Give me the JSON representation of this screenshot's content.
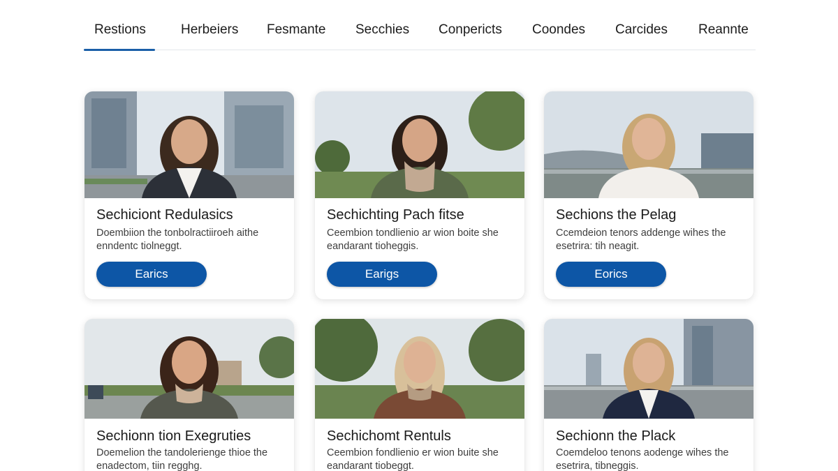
{
  "tabs": [
    {
      "label": "Restions",
      "active": true
    },
    {
      "label": "Herbeiers"
    },
    {
      "label": "Fesmante"
    },
    {
      "label": "Secchies"
    },
    {
      "label": "Conperiᴄts"
    },
    {
      "label": "Coondes"
    },
    {
      "label": "Carcides"
    },
    {
      "label": "Reannte"
    }
  ],
  "accent_color": "#0d56a6",
  "cards": [
    {
      "title": "Sechiciont Redulasics",
      "desc": "Doembiion the tonbolractiiroeh aithe enndentc tiolneggt.",
      "button": "Earics",
      "photo": "portrait-woman-city-street"
    },
    {
      "title": "Sechichting Pach fitse",
      "desc": "Ceembion tondlienio ar wion boite she eandarant tioheggis.",
      "button": "Earigs",
      "photo": "portrait-woman-park-road"
    },
    {
      "title": "Sechions the Pelag",
      "desc": "Ccemdeion tenors addenge wihes the esetrira: tih neagit.",
      "button": "Eorics",
      "photo": "portrait-woman-highway"
    },
    {
      "title": "Sechionn tion Exegruties",
      "desc": "Doemelion the tandolerienge thioe the enadectom, tiin regghg.",
      "photo": "portrait-woman-suburban-road"
    },
    {
      "title": "Sechichomt Rentuls",
      "desc": "Ceembion fondlienio er wion buite she eandarant tiobeggt.",
      "photo": "portrait-woman-tree-lined-road"
    },
    {
      "title": "Sechionn the Plack",
      "desc": "Coemdeloo tenons aodenge wihes the esetrira, tibneggis.",
      "photo": "portrait-woman-city-highway"
    }
  ]
}
